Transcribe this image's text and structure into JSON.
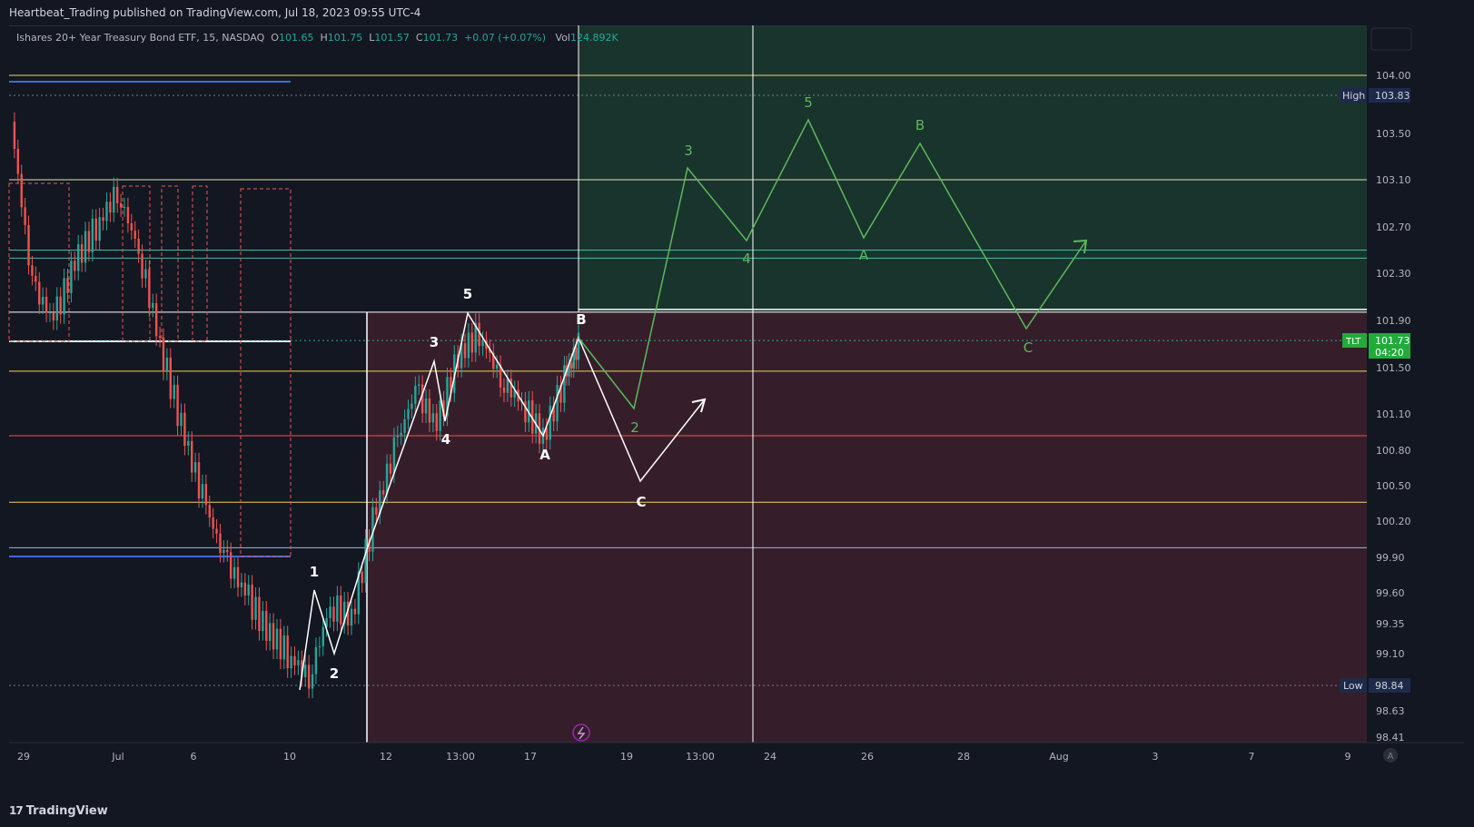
{
  "header": {
    "published": "Heartbeat_Trading published on TradingView.com, Jul 18, 2023 09:55 UTC-4"
  },
  "legend": {
    "symbol": "Ishares 20+ Year Treasury Bond ETF, 15, NASDAQ",
    "o_label": "O",
    "o": "101.65",
    "h_label": "H",
    "h": "101.75",
    "l_label": "L",
    "l": "101.57",
    "c_label": "C",
    "c": "101.73",
    "chg": "+0.07 (+0.07%)",
    "vol_label": "Vol",
    "vol": "124.892K"
  },
  "footer": {
    "brand": "TradingView",
    "brand_mark": "17"
  },
  "colors": {
    "bg": "#131722",
    "up": "#26a69a",
    "down": "#ef5350",
    "yellow_line": "#f0d060",
    "green_zone": "#1b3a2e",
    "red_zone": "#3a1f2b",
    "wave_white": "#ffffff",
    "wave_green": "#5cb85c",
    "blue_line": "#3d6bd8"
  },
  "chart_data": {
    "type": "line",
    "title": "",
    "instrument": "TLT",
    "y_axis": {
      "ticks": [
        "104.00",
        "103.50",
        "103.10",
        "102.70",
        "102.30",
        "101.90",
        "101.50",
        "101.10",
        "100.80",
        "100.50",
        "100.20",
        "99.90",
        "99.60",
        "99.35",
        "99.10",
        "98.63",
        "98.41"
      ],
      "range": [
        98.3,
        104.4
      ]
    },
    "x_axis": {
      "ticks": [
        "29",
        "Jul",
        "6",
        "10",
        "12",
        "13:00",
        "17",
        "19",
        "13:00",
        "24",
        "26",
        "28",
        "Aug",
        "3",
        "7",
        "9"
      ]
    },
    "price_labels": {
      "high_label": "High",
      "high": "103.83",
      "low_label": "Low",
      "low": "98.84",
      "current_symbol": "TLT",
      "current": "101.73",
      "countdown": "04:20",
      "auto_label": "A"
    },
    "horizontal_levels": [
      104.0,
      103.1,
      102.5,
      102.43,
      101.97,
      101.47,
      100.92,
      100.36,
      99.98
    ],
    "wave_white_labels": [
      "1",
      "2",
      "3",
      "4",
      "5",
      "A",
      "B",
      "C"
    ],
    "wave_green_labels": [
      "2",
      "3",
      "4",
      "5",
      "A",
      "B",
      "C"
    ],
    "price_series": [
      {
        "t": 0,
        "p": 103.6
      },
      {
        "t": 3,
        "p": 102.2
      },
      {
        "t": 6,
        "p": 101.9
      },
      {
        "t": 9,
        "p": 102.4
      },
      {
        "t": 12,
        "p": 102.7
      },
      {
        "t": 15,
        "p": 103.0
      },
      {
        "t": 18,
        "p": 102.5
      },
      {
        "t": 21,
        "p": 101.7
      },
      {
        "t": 24,
        "p": 101.0
      },
      {
        "t": 27,
        "p": 100.4
      },
      {
        "t": 30,
        "p": 99.9
      },
      {
        "t": 33,
        "p": 99.6
      },
      {
        "t": 36,
        "p": 99.3
      },
      {
        "t": 39,
        "p": 99.1
      },
      {
        "t": 42,
        "p": 98.9
      },
      {
        "t": 45,
        "p": 99.5
      },
      {
        "t": 48,
        "p": 99.4
      },
      {
        "t": 51,
        "p": 100.2
      },
      {
        "t": 54,
        "p": 100.8
      },
      {
        "t": 57,
        "p": 101.3
      },
      {
        "t": 60,
        "p": 101.0
      },
      {
        "t": 63,
        "p": 101.6
      },
      {
        "t": 66,
        "p": 101.8
      },
      {
        "t": 69,
        "p": 101.4
      },
      {
        "t": 72,
        "p": 101.2
      },
      {
        "t": 75,
        "p": 100.9
      },
      {
        "t": 78,
        "p": 101.4
      },
      {
        "t": 80,
        "p": 101.7
      }
    ]
  }
}
